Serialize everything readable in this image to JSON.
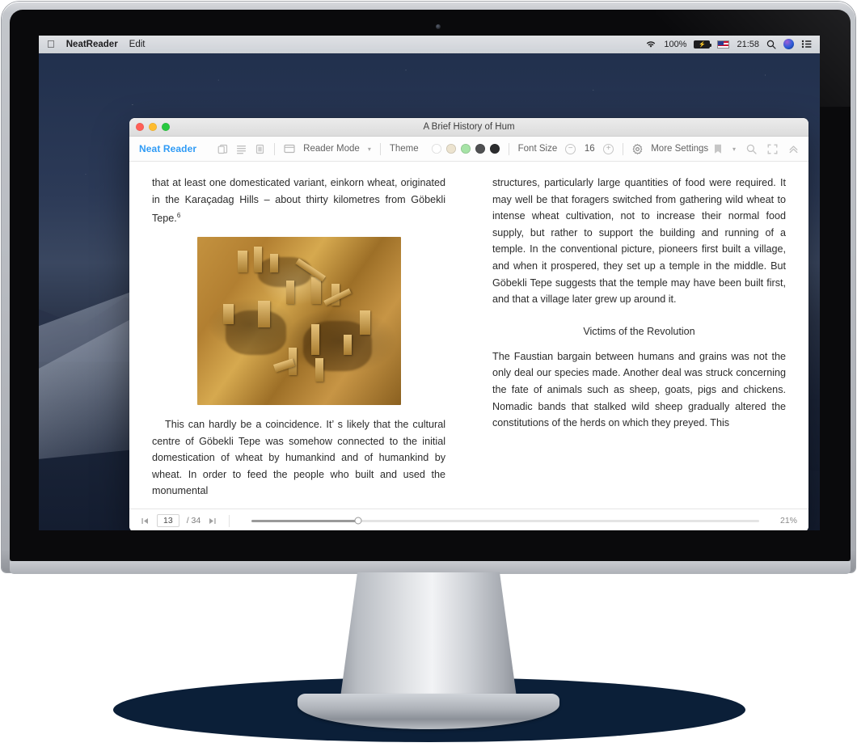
{
  "desktop": {
    "menubar": {
      "apple_logo": "apple-logo",
      "app_name": "NeatReader",
      "menus": [
        "Edit"
      ],
      "status": {
        "wifi_icon": "wifi-icon",
        "battery_percent": "100%",
        "battery_icon": "battery-charging-icon",
        "input_source": "us-flag-icon",
        "clock": "21:58",
        "search_icon": "spotlight-search-icon",
        "siri_icon": "siri-icon",
        "control_center_icon": "control-center-icon"
      }
    },
    "wallpaper": "mojave-night-desert"
  },
  "window": {
    "title": "A Brief History of Hum",
    "traffic_lights": [
      "close",
      "minimize",
      "zoom"
    ]
  },
  "toolbar": {
    "brand": "Neat Reader",
    "view_icons": [
      "two-page-view-icon",
      "scroll-view-icon",
      "single-page-view-icon"
    ],
    "reader_mode_icon": "reader-mode-icon",
    "reader_mode_label": "Reader Mode",
    "theme_label": "Theme",
    "theme_swatches": [
      {
        "name": "white",
        "color": "#ffffff",
        "selected": false
      },
      {
        "name": "sepia",
        "color": "#ece3cf",
        "selected": false
      },
      {
        "name": "green",
        "color": "#a6e3a6",
        "selected": true
      },
      {
        "name": "dark-gray",
        "color": "#4f5052",
        "selected": false
      },
      {
        "name": "black",
        "color": "#2b2c2e",
        "selected": false
      }
    ],
    "font_size_label": "Font Size",
    "font_size_value": "16",
    "font_decrease": "−",
    "font_increase": "+",
    "settings_icon": "gear-icon",
    "settings_label": "More Settings",
    "right_icons": [
      "bookmark-icon",
      "chevron-down-icon",
      "search-icon",
      "fullscreen-icon",
      "collapse-toolbar-icon"
    ]
  },
  "content": {
    "left_column": {
      "paragraph_continued": "that at least one domesticated variant, einkorn wheat, originated in the Karaçadag Hills – about thirty kilometres from Göbekli Tepe.",
      "footnote_marker": "6",
      "figure": {
        "name": "gobekli-tepe-excavation-photo",
        "alt": "Aerial photograph of the Göbekli Tepe archaeological excavation site"
      },
      "paragraph_2": "This can hardly be a coincidence. It’ s likely that the cultural centre of Göbekli Tepe was somehow connected to the initial domestication of wheat by humankind and of humankind by wheat. In order to feed the people who built and used the monumental"
    },
    "right_column": {
      "paragraph_continued": "structures, particularly large quantities of food were required. It may well be that foragers switched from gathering wild wheat to intense wheat cultivation, not to increase their normal food supply, but rather to support the building and running of a temple. In the conventional picture, pioneers first built a village, and when it prospered, they set up a temple in the middle. But Göbekli Tepe suggests that the temple may have been built first, and that a village later grew up around it.",
      "section_heading": "Victims of the Revolution",
      "paragraph_2": "The Faustian bargain between humans and grains was not the only deal our species made. Another deal was struck concerning the fate of animals such as sheep, goats, pigs and chickens. Nomadic bands that stalked wild sheep gradually altered the constitutions of the herds on which they preyed. This"
    }
  },
  "footer": {
    "first_page_icon": "first-page-icon",
    "current_page": "13",
    "total_pages": "/ 34",
    "last_page_icon": "last-page-icon",
    "progress_percent": "21%",
    "progress_value": 21
  }
}
